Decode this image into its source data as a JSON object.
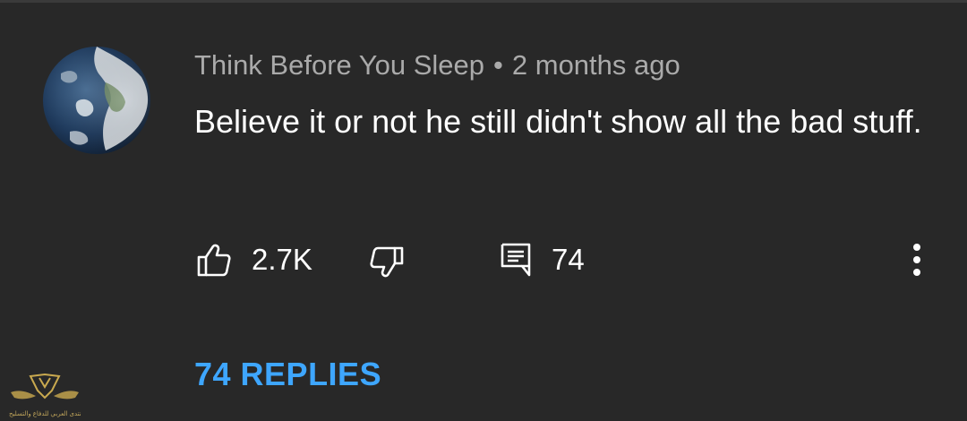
{
  "comment": {
    "author": "Think Before You Sleep",
    "separator": "•",
    "timestamp": "2 months ago",
    "text": "Believe it or not he still didn't show all the bad stuff.",
    "avatar_icon": "earth-globe-avatar"
  },
  "actions": {
    "like_icon": "thumbs-up-icon",
    "like_count": "2.7K",
    "dislike_icon": "thumbs-down-icon",
    "reply_icon": "comment-icon",
    "reply_count": "74",
    "more_icon": "kebab-menu-icon"
  },
  "replies_label": "74 REPLIES",
  "watermark": {
    "text": "المنتدى العربي للدفاع والتسليح"
  },
  "colors": {
    "background": "#282828",
    "meta_text": "#aaaaaa",
    "body_text": "#ffffff",
    "replies_link": "#3ea6ff"
  }
}
